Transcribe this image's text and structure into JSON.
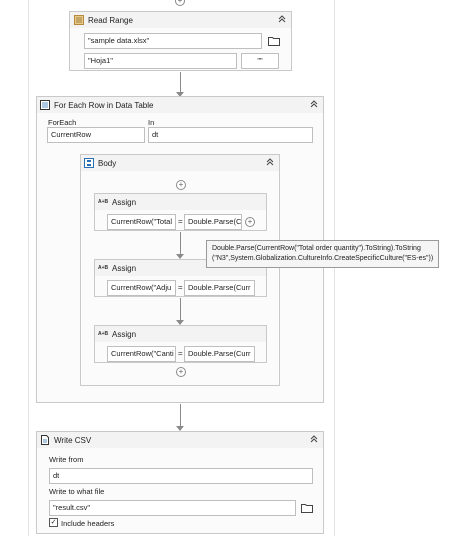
{
  "read_range": {
    "title": "Read Range",
    "workbook": "\"sample data.xlsx\"",
    "sheet": "\"Hoja1\"",
    "range": "\"\""
  },
  "for_each": {
    "title": "For Each Row in Data Table",
    "foreach_label": "ForEach",
    "foreach_value": "CurrentRow",
    "in_label": "In",
    "in_value": "dt"
  },
  "body": {
    "title": "Body",
    "assigns": [
      {
        "title": "Assign",
        "to": "CurrentRow(\"Total",
        "value": "Double.Parse(C"
      },
      {
        "title": "Assign",
        "to": "CurrentRow(\"Adju",
        "value": "Double.Parse(Curr"
      },
      {
        "title": "Assign",
        "to": "CurrentRow(\"Canti",
        "value": "Double.Parse(Curr"
      }
    ],
    "assign_icon_text": "A+B",
    "equals": "="
  },
  "tooltip": {
    "line1": "Double.Parse(CurrentRow(\"Total order quantity\").ToString).ToString",
    "line2": "(\"N3\",System.Globalization.CultureInfo.CreateSpecificCulture(\"ES-es\"))"
  },
  "write_csv": {
    "title": "Write CSV",
    "write_from_label": "Write from",
    "write_from_value": "dt",
    "write_to_label": "Write to what file",
    "write_to_value": "\"result.csv\"",
    "include_headers_label": "Include headers",
    "include_headers_checked": true
  },
  "icons": {
    "collapse": "chevron-up-double-icon",
    "folder": "folder-icon",
    "add": "add-circle-icon"
  }
}
